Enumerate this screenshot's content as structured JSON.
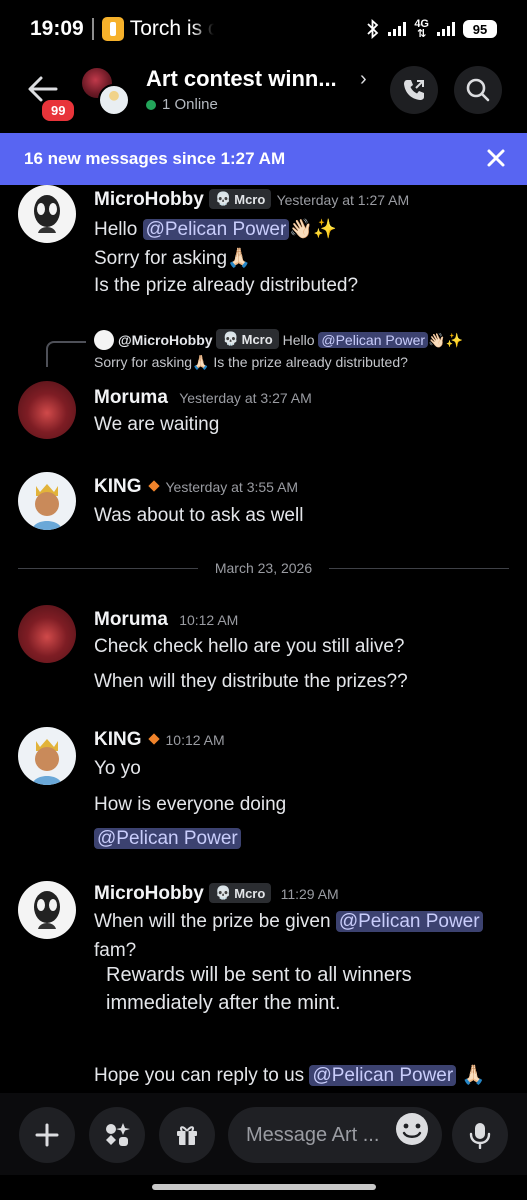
{
  "status_bar": {
    "time": "19:09",
    "app_text": "Torch is o",
    "network": "4G",
    "battery": "95"
  },
  "header": {
    "channel_title": "Art contest winn...",
    "online_text": "1 Online",
    "unread_badge": "99"
  },
  "banner": {
    "text": "16 new messages since 1:27 AM"
  },
  "messages": {
    "m1": {
      "author": "MicroHobby",
      "tag": "Mcro",
      "time": "Yesterday at 1:27 AM",
      "l1_pre": "Hello ",
      "l1_mention": "@Pelican Power",
      "l1_emoji": "👋🏻✨",
      "l2": "Sorry for asking🙏🏻",
      "l3": "Is the prize already distributed?"
    },
    "reply": {
      "author": "@MicroHobby",
      "tag": "Mcro",
      "pre": "Hello ",
      "mention": "@Pelican Power",
      "emoji": "👋🏻✨",
      "l2": "Sorry for asking🙏🏻 Is the prize already distributed?"
    },
    "m2": {
      "author": "Moruma",
      "time": "Yesterday at 3:27 AM",
      "l1": "We are waiting"
    },
    "m3": {
      "author": "KING",
      "time": "Yesterday at 3:55 AM",
      "l1": "Was about to ask as well"
    },
    "divider": "March 23, 2026",
    "m4": {
      "author": "Moruma",
      "time": "10:12 AM",
      "l1": "Check check hello are you still alive?",
      "l2": "When will they distribute the prizes??"
    },
    "m5": {
      "author": "KING",
      "time": "10:12 AM",
      "l1": "Yo yo",
      "l2": "How is everyone doing",
      "l3_mention": "@Pelican Power"
    },
    "m6": {
      "author": "MicroHobby",
      "tag": "Mcro",
      "time": "11:29 AM",
      "l1_pre": "When will the prize be given ",
      "l1_mention": "@Pelican Power",
      "l2": "fam?",
      "embed": "Rewards will be sent to all winners immediately after the mint.",
      "l3_pre": "Hope you can reply to us ",
      "l3_mention": "@Pelican Power",
      "l3_emoji": "🙏🏻"
    }
  },
  "composer": {
    "placeholder": "Message Art ..."
  },
  "icons": [
    "back-arrow-icon",
    "phone-icon",
    "search-icon",
    "close-icon",
    "plus-icon",
    "apps-icon",
    "gift-icon",
    "emoji-icon",
    "microphone-icon"
  ]
}
